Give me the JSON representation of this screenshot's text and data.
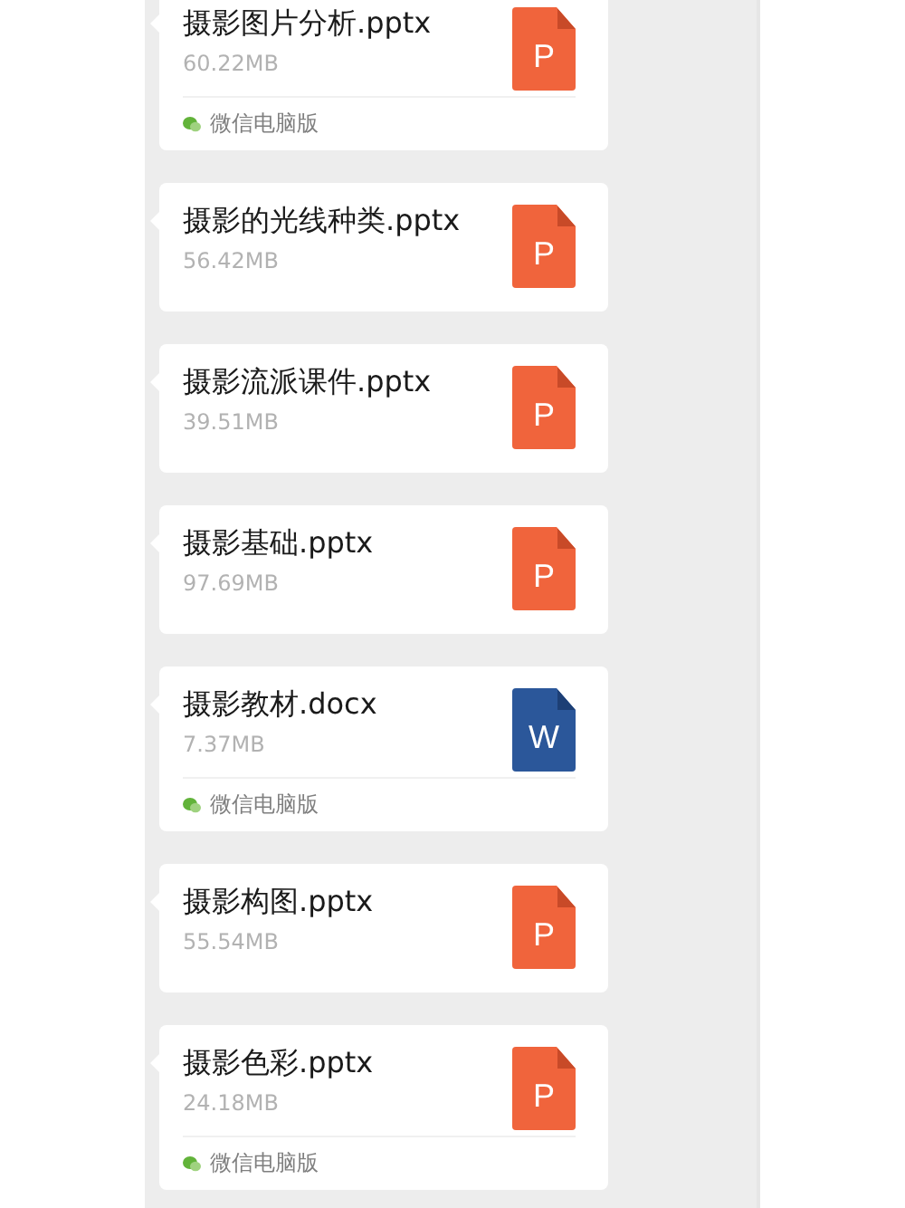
{
  "messages": [
    {
      "name": "摄影图片分析.pptx",
      "size": "60.22MB",
      "kind": "ppt",
      "icon_letter": "P",
      "source": "微信电脑版"
    },
    {
      "name": "摄影的光线种类.pptx",
      "size": "56.42MB",
      "kind": "ppt",
      "icon_letter": "P"
    },
    {
      "name": "摄影流派课件.pptx",
      "size": "39.51MB",
      "kind": "ppt",
      "icon_letter": "P"
    },
    {
      "name": "摄影基础.pptx",
      "size": "97.69MB",
      "kind": "ppt",
      "icon_letter": "P"
    },
    {
      "name": "摄影教材.docx",
      "size": "7.37MB",
      "kind": "word",
      "icon_letter": "W",
      "source": "微信电脑版"
    },
    {
      "name": "摄影构图.pptx",
      "size": "55.54MB",
      "kind": "ppt",
      "icon_letter": "P"
    },
    {
      "name": "摄影色彩.pptx",
      "size": "24.18MB",
      "kind": "ppt",
      "icon_letter": "P",
      "source": "微信电脑版"
    }
  ]
}
